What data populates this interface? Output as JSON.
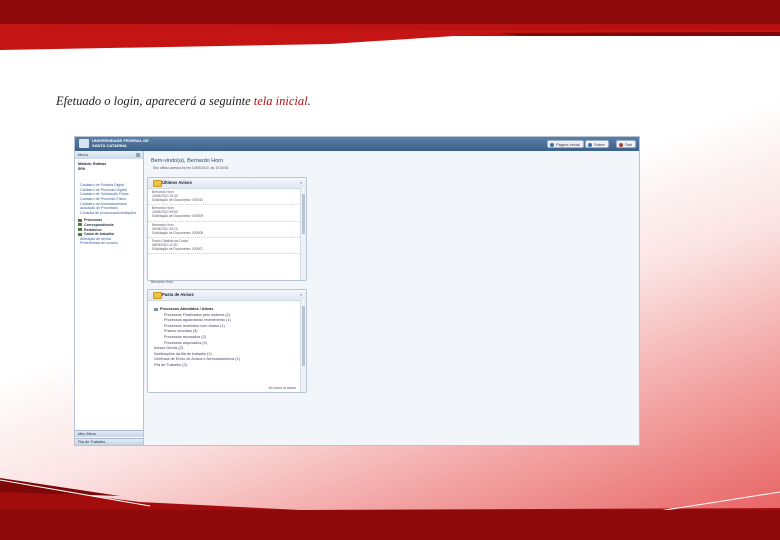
{
  "caption": {
    "prefix": "Efetuado o login, aparecerá a seguinte ",
    "highlight": "tela inicial",
    "suffix": "."
  },
  "colors": {
    "accent_dark": "#8e0a0a",
    "accent": "#c41414",
    "highlight_text": "#b11212",
    "app_blue": "#2a4d7a"
  },
  "app": {
    "institution": "UNIVERSIDADE FEDERAL DE SANTA CATARINA",
    "buttons": [
      {
        "label": "Página inicial",
        "icon": "home-icon"
      },
      {
        "label": "Sobre",
        "icon": "info-icon"
      },
      {
        "label": "Sair",
        "icon": "exit-icon"
      }
    ]
  },
  "sidebar": {
    "header": "Menu",
    "module_label": "Módulo: Rotinas",
    "module_value": "SPA",
    "links": [
      "Cadastro de Entrada Digital",
      "Cadastro de Processo Digital",
      "Cadastro de Solicitação Física",
      "Cadastro de Processo Físico",
      "Cadastro de Arrecadamentos",
      "Autuação de Processos",
      "Consulta de processos/solicitações"
    ],
    "sections": [
      "Processos",
      "Correspondência",
      "Relatórios",
      "Caixa de trabalho"
    ],
    "sub_links": [
      "Alteração de senha",
      "Preferências de usuário"
    ],
    "footer_items": [
      "Meu Menu",
      "Fila de Trabalho"
    ]
  },
  "main": {
    "welcome": "Bem-vindo(a), Bernardo Horn",
    "last_access": "Seu último acesso foi em 10/09/2010, às 10:30:50",
    "panel_recent": {
      "title": "Últimos Avisos",
      "items": [
        {
          "name": "Bernardo Horn",
          "date": "10/09/2010 10:30",
          "text": "Solicitação de Documento: 000010"
        },
        {
          "name": "Bernardo Horn",
          "date": "10/09/2010 09:50",
          "text": "Solicitação de Documento: 000009"
        },
        {
          "name": "Bernardo Horn",
          "date": "09/09/2010 15:10",
          "text": "Solicitação de Documento: 000008"
        },
        {
          "name": "Paulo Cândido da Costa",
          "date": "08/09/2010 11:00",
          "text": "Solicitação de Documento: 000007"
        }
      ],
      "footer": "Bernardo Horn"
    },
    "panel_pasta": {
      "title": "Pasta de Avisos",
      "header_line": "Processos Atendidos / Ativos",
      "lines": [
        "Processos Finalizados pelo sistema (2)",
        "Processos aguardando recebimento (1)",
        "Processos recebidos com atraso (1)",
        "Prazos vencidos (3)",
        "Processos recusados (2)",
        "Processos arquivados (4)"
      ],
      "extra_lines": [
        "Avisos Gerais (2)",
        "Notificações da fila de trabalho (1)",
        "Gerência de Envio de Avisos e Arrecadamentos (1)",
        "Fila de Trabalho (2)"
      ],
      "more": "Ver todos os avisos"
    }
  }
}
